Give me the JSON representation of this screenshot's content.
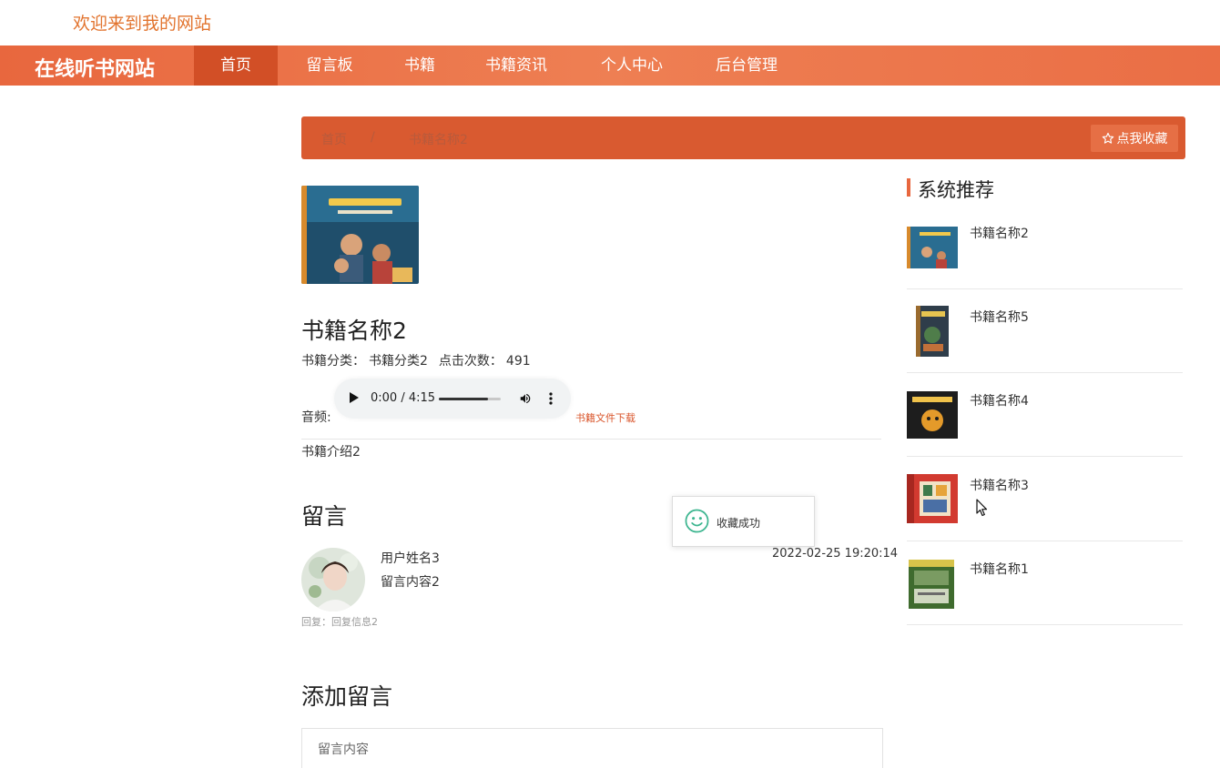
{
  "header": {
    "welcome": "欢迎来到我的网站"
  },
  "nav": {
    "site_name": "在线听书网站",
    "items": [
      {
        "label": "首页",
        "active": true
      },
      {
        "label": "留言板",
        "active": false
      },
      {
        "label": "书籍",
        "active": false
      },
      {
        "label": "书籍资讯",
        "active": false
      },
      {
        "label": "个人中心",
        "active": false
      },
      {
        "label": "后台管理",
        "active": false
      }
    ]
  },
  "breadcrumb": {
    "home": "首页",
    "separator": "/",
    "current": "书籍名称2"
  },
  "favorite_button": {
    "label": "点我收藏",
    "icon": "star-outline-icon"
  },
  "book": {
    "title": "书籍名称2",
    "category_label": "书籍分类：",
    "category_value": "书籍分类2",
    "clicks_label": "点击次数：",
    "clicks_value": "491",
    "audio_label": "音频:",
    "audio_time": "0:00 / 4:15",
    "audio_volume_level": 0.8,
    "download_label": "书籍文件下载",
    "intro": "书籍介绍2"
  },
  "comments": {
    "title": "留言",
    "items": [
      {
        "user": "用户姓名3",
        "content": "留言内容2",
        "date": "2022-02-25 19:20:14",
        "reply": "回复：回复信息2"
      }
    ]
  },
  "toast": {
    "message": "收藏成功",
    "icon": "smile-icon"
  },
  "add_comment": {
    "title": "添加留言",
    "placeholder": "留言内容"
  },
  "recommend": {
    "title": "系统推荐",
    "items": [
      {
        "name": "书籍名称2"
      },
      {
        "name": "书籍名称5"
      },
      {
        "name": "书籍名称4"
      },
      {
        "name": "书籍名称3"
      },
      {
        "name": "书籍名称1"
      }
    ]
  },
  "colors": {
    "accent": "#e8673e",
    "nav_active": "#d24f26",
    "breadcrumb_bg": "#d95a30",
    "welcome": "#e2742f"
  }
}
